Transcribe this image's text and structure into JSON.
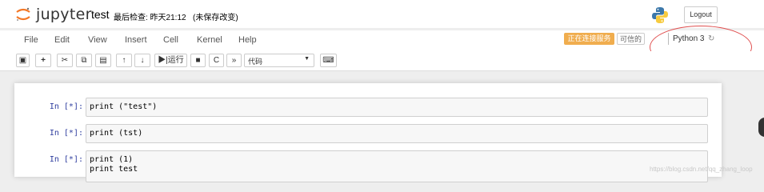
{
  "header": {
    "brand": "jupyter",
    "notebook_name": "test",
    "checkpoint": "最后检查: 昨天21:12",
    "autosave": "(未保存改变)",
    "logout_label": "Logout"
  },
  "menubar": {
    "items": [
      "File",
      "Edit",
      "View",
      "Insert",
      "Cell",
      "Kernel",
      "Help"
    ],
    "status_busy": "正在连接服务",
    "trusted": "可信的",
    "kernel_name": "Python 3"
  },
  "toolbar": {
    "run_label": "运行",
    "cell_type": "代码"
  },
  "cells": [
    {
      "prompt": "In [*]:",
      "code": [
        "print (\"test\")"
      ]
    },
    {
      "prompt": "In [*]:",
      "code": [
        "print (tst)"
      ]
    },
    {
      "prompt": "In [*]:",
      "code": [
        "print (1)",
        "print test"
      ]
    }
  ],
  "watermark": "https://blog.csdn.net/qq_zhang_loop",
  "colors": {
    "busy_badge": "#f0ad4e",
    "prompt_in": "#303f9f",
    "annotation": "#e05050"
  },
  "icons": [
    "jupyter-logo-icon",
    "python-logo-icon",
    "save-icon",
    "plus-icon",
    "cut-icon",
    "copy-icon",
    "paste-icon",
    "arrow-up-icon",
    "arrow-down-icon",
    "step-icon",
    "stop-icon",
    "restart-icon",
    "fast-forward-icon",
    "keyboard-icon",
    "kernel-busy-icon"
  ]
}
